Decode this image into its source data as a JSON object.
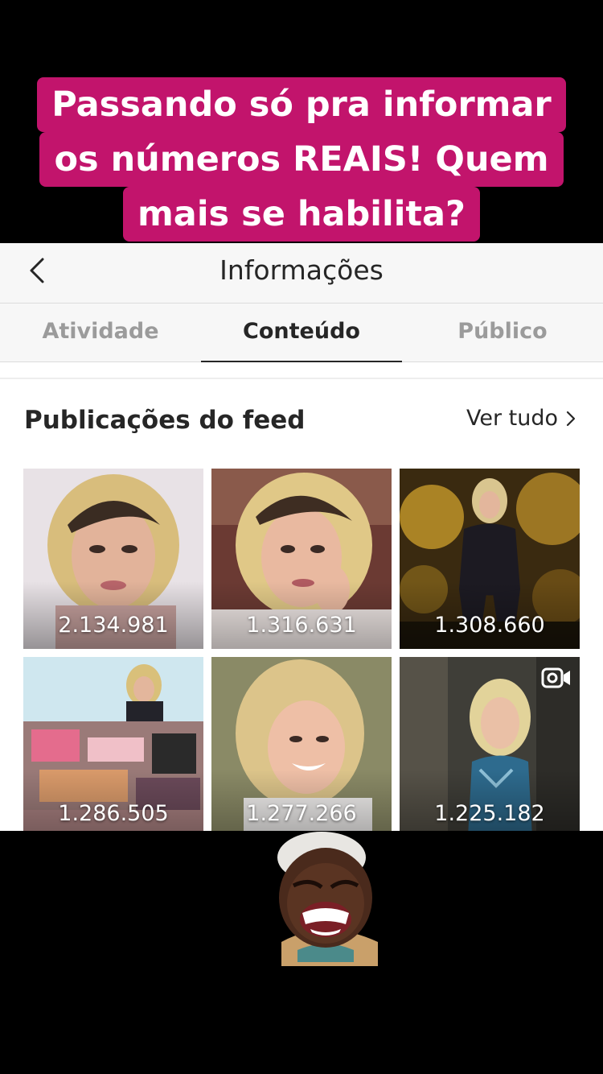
{
  "caption": {
    "line1": "Passando só pra informar",
    "line2": "os números  REAIS!  Quem",
    "line3": "mais se habilita?"
  },
  "header": {
    "title": "Informações",
    "back_icon": "chevron-left-icon"
  },
  "tabs": [
    {
      "label": "Atividade",
      "active": false
    },
    {
      "label": "Conteúdo",
      "active": true
    },
    {
      "label": "Público",
      "active": false
    }
  ],
  "feed": {
    "title": "Publicações do feed",
    "see_all": "Ver tudo",
    "posts": [
      {
        "count": "2.134.981"
      },
      {
        "count": "1.316.631"
      },
      {
        "count": "1.308.660"
      },
      {
        "count": "1.286.505"
      },
      {
        "count": "1.277.266"
      },
      {
        "count": "1.225.182",
        "type": "video"
      }
    ]
  },
  "colors": {
    "caption_bg": "#c2146c",
    "panel_bg": "#ffffff",
    "bar_bg": "#f7f7f7"
  }
}
